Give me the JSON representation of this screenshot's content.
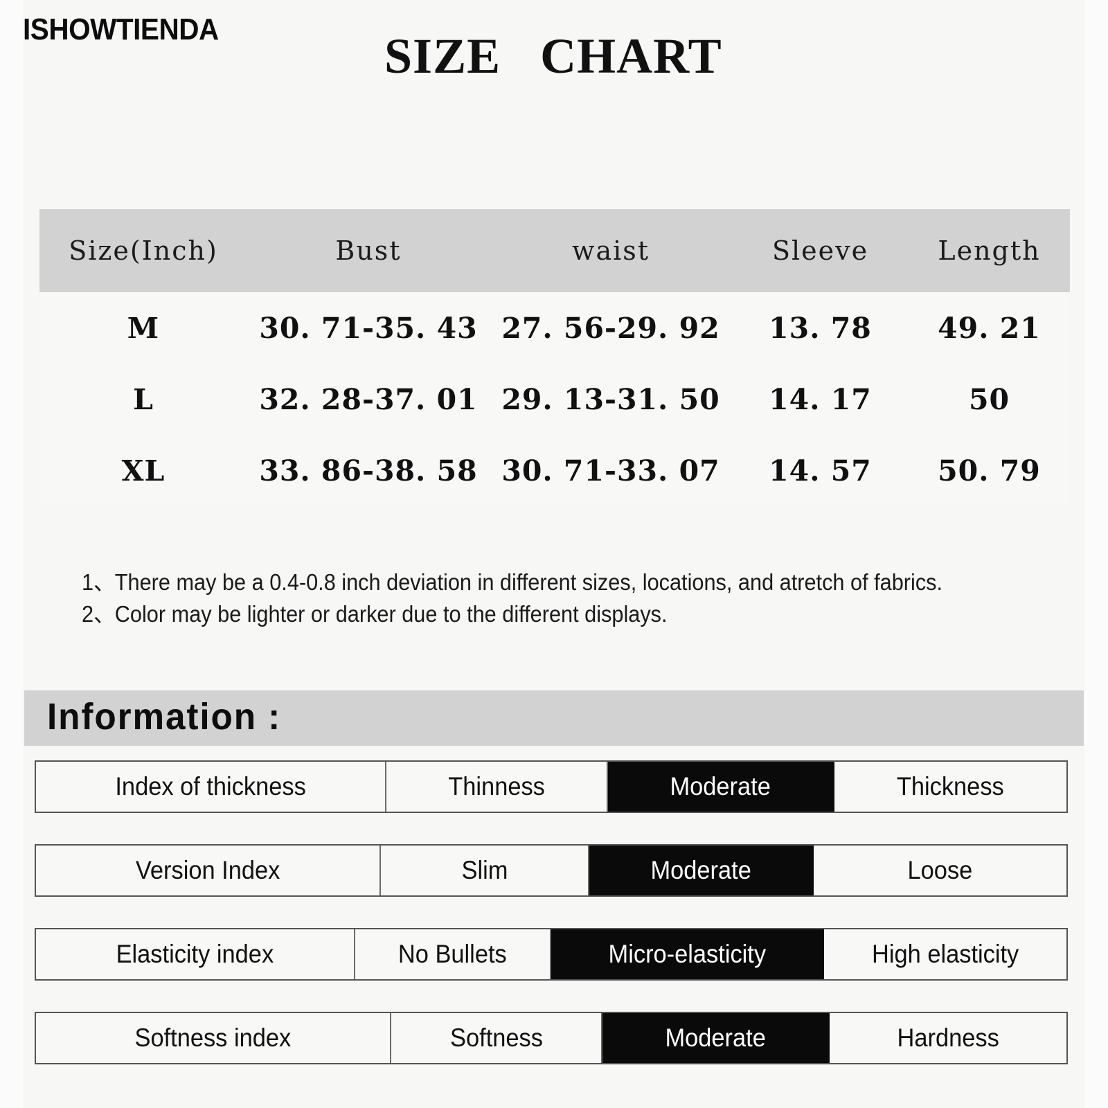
{
  "brand": "ISHOWTIENDA",
  "title": "SIZE   CHART",
  "size_chart": {
    "headers": [
      "Size(Inch)",
      "Bust",
      "waist",
      "Sleeve",
      "Length"
    ],
    "rows": [
      {
        "size": "M",
        "bust": "30. 71-35. 43",
        "waist": "27. 56-29. 92",
        "sleeve": "13. 78",
        "length": "49. 21"
      },
      {
        "size": "L",
        "bust": "32. 28-37. 01",
        "waist": "29. 13-31. 50",
        "sleeve": "14. 17",
        "length": "50"
      },
      {
        "size": "XL",
        "bust": "33. 86-38. 58",
        "waist": "30. 71-33. 07",
        "sleeve": "14. 57",
        "length": "50. 79"
      }
    ]
  },
  "notes": [
    "1、There may be a 0.4-0.8 inch deviation in different sizes, locations, and atretch of fabrics.",
    "2、Color may be lighter or darker due to the different displays."
  ],
  "information": {
    "heading": "Information :",
    "rows": [
      {
        "label": "Index of thickness",
        "options": [
          "Thinness",
          "Moderate",
          "Thickness"
        ],
        "selected_index": 1
      },
      {
        "label": "Version Index",
        "options": [
          "Slim",
          "Moderate",
          "Loose"
        ],
        "selected_index": 1
      },
      {
        "label": "Elasticity index",
        "options": [
          "No Bullets",
          "Micro-elasticity",
          "High elasticity"
        ],
        "selected_index": 1
      },
      {
        "label": "Softness index",
        "options": [
          "Softness",
          "Moderate",
          "Hardness"
        ],
        "selected_index": 1
      }
    ]
  },
  "colors": {
    "page_background": "#f7f7f6",
    "header_band": "#d2d2d2",
    "highlight_background": "#0a0a0a",
    "highlight_text": "#ffffff",
    "text": "#111111",
    "cell_border": "#555555"
  }
}
